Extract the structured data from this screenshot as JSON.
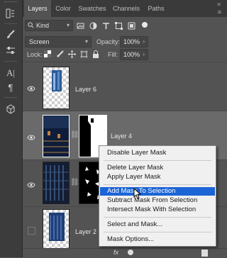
{
  "panel": {
    "tabs": [
      "Layers",
      "Color",
      "Swatches",
      "Channels",
      "Paths"
    ],
    "close_glyph": "✕",
    "menu_glyph": "≡"
  },
  "filter": {
    "kind_label": "Kind",
    "icons": [
      "pixel-filter-icon",
      "adjustment-filter-icon",
      "type-filter-icon",
      "shape-filter-icon",
      "smart-object-filter-icon"
    ]
  },
  "blend": {
    "mode": "Screen",
    "opacity_label": "Opacity:",
    "opacity_value": "100%"
  },
  "lock": {
    "label": "Lock:",
    "fill_label": "Fill:",
    "fill_value": "100%"
  },
  "layers": [
    {
      "name": "Layer 6",
      "visible": true,
      "has_mask": false,
      "selected": false
    },
    {
      "name": "Layer 4",
      "visible": true,
      "has_mask": true,
      "selected": true
    },
    {
      "name": "",
      "visible": true,
      "has_mask": true,
      "selected": false
    },
    {
      "name": "Layer 2",
      "visible": false,
      "has_mask": false,
      "selected": false
    }
  ],
  "context_menu": {
    "items": [
      "Disable Layer Mask",
      "Delete Layer Mask",
      "Apply Layer Mask",
      "Add Mask To Selection",
      "Subtract Mask From Selection",
      "Intersect Mask With Selection",
      "Select and Mask...",
      "Mask Options..."
    ],
    "highlighted": "Add Mask To Selection"
  },
  "bottom_bar": {
    "fx_label": "fx"
  },
  "colors": {
    "panel_bg": "#535353",
    "tab_bar": "#3a3a3a",
    "highlight": "#1b65d6",
    "selected_row": "#6a6a6a"
  }
}
